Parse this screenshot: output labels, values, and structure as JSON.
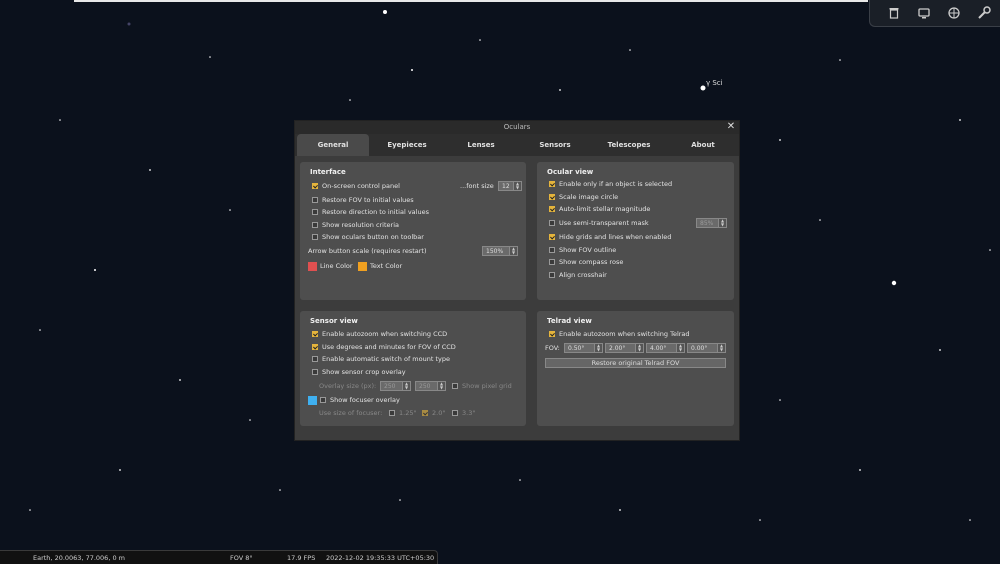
{
  "sky": {
    "star_label": "γ Sci"
  },
  "toolbar": {
    "icons": [
      "trash-icon",
      "monitor-icon",
      "globe-icon",
      "wrench-icon"
    ]
  },
  "dialog": {
    "title": "Oculars",
    "tabs": [
      "General",
      "Eyepieces",
      "Lenses",
      "Sensors",
      "Telescopes",
      "About"
    ],
    "interface": {
      "title": "Interface",
      "items": [
        {
          "label": "On-screen control panel",
          "checked": true
        },
        {
          "label": "Restore FOV to initial values",
          "checked": false
        },
        {
          "label": "Restore direction to initial values",
          "checked": false
        },
        {
          "label": "Show resolution criteria",
          "checked": false
        },
        {
          "label": "Show oculars button on toolbar",
          "checked": false
        }
      ],
      "font_size_label": "...font size",
      "font_size_value": "12",
      "arrow_scale_label": "Arrow button scale (requires restart)",
      "arrow_scale_value": "150%",
      "line_color_label": "Line Color",
      "text_color_label": "Text Color"
    },
    "ocular": {
      "title": "Ocular view",
      "items": [
        {
          "label": "Enable only if an object is selected",
          "checked": true
        },
        {
          "label": "Scale image circle",
          "checked": true
        },
        {
          "label": "Auto-limit stellar magnitude",
          "checked": true
        },
        {
          "label": "Use semi-transparent mask",
          "checked": false
        },
        {
          "label": "Hide grids and lines when enabled",
          "checked": true
        },
        {
          "label": "Show FOV outline",
          "checked": false
        },
        {
          "label": "Show compass rose",
          "checked": false
        },
        {
          "label": "Align crosshair",
          "checked": false
        }
      ],
      "mask_value": "85%"
    },
    "sensor": {
      "title": "Sensor view",
      "items": [
        {
          "label": "Enable autozoom when switching CCD",
          "checked": true
        },
        {
          "label": "Use degrees and minutes for FOV of CCD",
          "checked": true
        },
        {
          "label": "Enable automatic switch of mount type",
          "checked": false
        },
        {
          "label": "Show sensor crop overlay",
          "checked": false
        }
      ],
      "overlay_size_label": "Overlay size (px):",
      "overlay_w": "250",
      "overlay_h": "250",
      "pixel_grid_label": "Show pixel grid",
      "focuser_label": "Show focuser overlay",
      "focuser_size_label": "Use size of focuser:",
      "focuser_sizes": [
        "1.25\"",
        "2.0\"",
        "3.3\""
      ]
    },
    "telrad": {
      "title": "Telrad view",
      "autozoom_label": "Enable autozoom when switching Telrad",
      "fov_label": "FOV:",
      "fov_values": [
        "0.50°",
        "2.00°",
        "4.00°",
        "0.00°"
      ],
      "restore_label": "Restore original Telrad FOV"
    }
  },
  "status": {
    "location": "Earth, 20.0063, 77.006, 0 m",
    "fov": "FOV 8°",
    "fps": "17.9 FPS",
    "datetime": "2022-12-02 19:35:33 UTC+05:30"
  },
  "colors": {
    "checkbox": "#e4b43c",
    "line_color": "#e05050",
    "text_color": "#f0a020",
    "focuser": "#3fb0f0"
  }
}
